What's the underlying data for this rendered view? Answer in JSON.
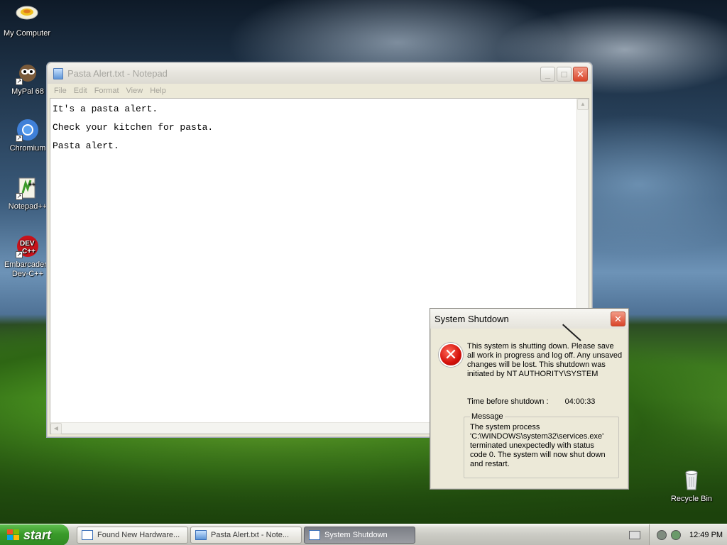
{
  "desktop": {
    "icons": [
      {
        "label": "My Computer",
        "icon": "my-computer-icon"
      },
      {
        "label": "MyPal 68",
        "icon": "mypal-browser-icon"
      },
      {
        "label": "Chromium",
        "icon": "chromium-icon"
      },
      {
        "label": "Notepad++",
        "icon": "notepad-plus-plus-icon"
      },
      {
        "label": "Embarcadero Dev-C++",
        "icon": "dev-cpp-icon",
        "label_line1": "Embarcadero",
        "label_line2": "Dev-C++"
      },
      {
        "label": "Recycle Bin",
        "icon": "recycle-bin-icon"
      }
    ]
  },
  "notepad": {
    "title": "Pasta Alert.txt - Notepad",
    "menu": [
      "File",
      "Edit",
      "Format",
      "View",
      "Help"
    ],
    "lines": [
      "It's a pasta alert.",
      "Check your kitchen for pasta.",
      "Pasta alert."
    ]
  },
  "shutdown_dialog": {
    "title": "System Shutdown",
    "message": "This system is shutting down. Please save all work in progress and log off. Any unsaved changes will be lost. This shutdown was initiated by NT AUTHORITY\\SYSTEM",
    "time_label": "Time before shutdown :",
    "time_value": "04:00:33",
    "group_label": "Message",
    "group_text": "The system process 'C:\\WINDOWS\\system32\\services.exe' terminated unexpectedly with status code 0.  The system will now shut down and restart."
  },
  "taskbar": {
    "start_label": "start",
    "tasks": [
      {
        "label": "Found New Hardware...",
        "active": false
      },
      {
        "label": "Pasta Alert.txt - Note...",
        "active": false
      },
      {
        "label": "System Shutdown",
        "active": true
      }
    ],
    "clock": "12:49 PM"
  },
  "colors": {
    "start_green": "#3a9a2a",
    "close_red": "#d9452a",
    "error_red": "#d4100a"
  }
}
